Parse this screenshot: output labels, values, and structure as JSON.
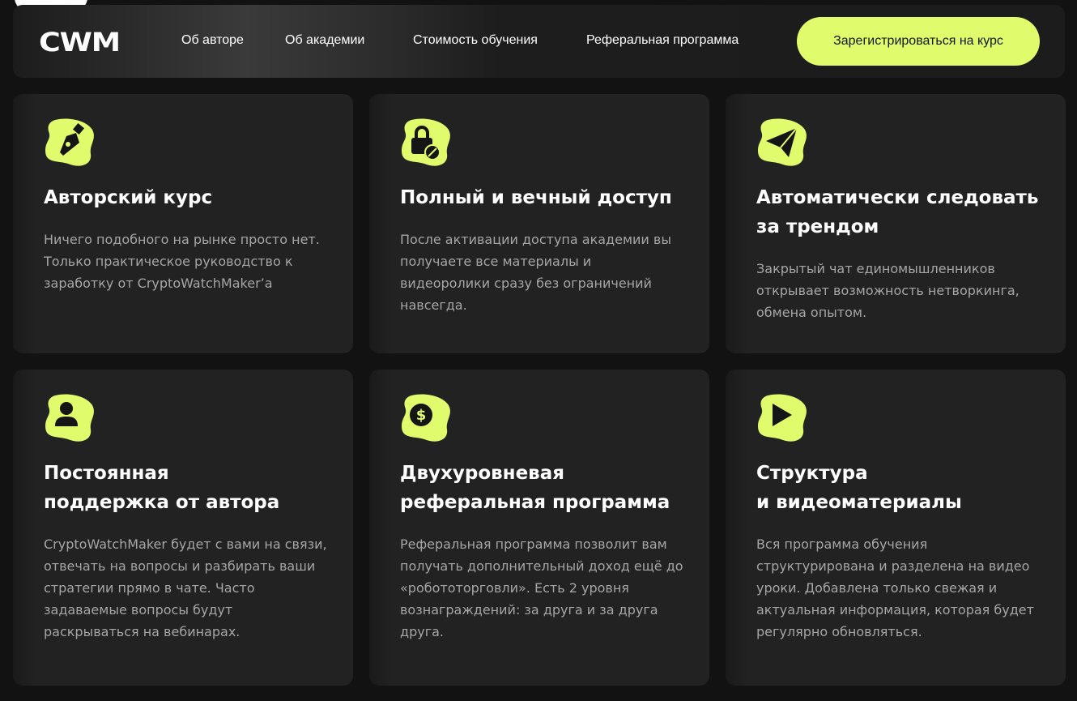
{
  "header": {
    "logo_text": "CWM",
    "nav": [
      {
        "label": "Об авторе"
      },
      {
        "label": "Об академии"
      },
      {
        "label": "Стоимость обучения"
      },
      {
        "label": "Реферальная программа"
      }
    ],
    "cta_label": "Зарегистрироваться на курс"
  },
  "colors": {
    "accent": "#e0fc6c",
    "background": "#121212",
    "card": "#222222",
    "text_muted": "#a6a6a6"
  },
  "features": [
    {
      "icon": "pen-nib-icon",
      "title_lines": [
        "Авторский курс"
      ],
      "description": "Ничего подобного на рынке просто нет. Только практическое руководство к заработку от CryptoWatchMaker’a"
    },
    {
      "icon": "lock-infinity-icon",
      "title_lines": [
        "Полный и вечный доступ"
      ],
      "description": "После активации доступа академии вы получаете все материалы и видеоролики сразу без ограничений навсегда."
    },
    {
      "icon": "paper-plane-icon",
      "title_lines": [
        "Автоматически следовать",
        "за трендом"
      ],
      "description": "Закрытый чат единомышленников открывает возможность нетворкинга, обмена опытом."
    },
    {
      "icon": "user-icon",
      "title_lines": [
        "Постоянная",
        "поддержка от автора"
      ],
      "description": "CryptoWatchMaker будет с вами на связи, отвечать на вопросы и разбирать ваши стратегии прямо в чате. Часто задаваемые вопросы будут раскрываться на вебинарах."
    },
    {
      "icon": "dollar-coin-icon",
      "title_lines": [
        "Двухуровневая",
        "реферальная программа"
      ],
      "description": "Реферальная программа позволит вам получать дополнительный доход ещё до «робототорговли». Есть 2 уровня вознаграждений: за друга и за друга друга."
    },
    {
      "icon": "play-icon",
      "title_lines": [
        "Структура",
        "и видеоматериалы"
      ],
      "description": "Вся программа обучения структурирована и разделена на видео уроки. Добавлена только свежая и актуальная информация, которая будет регулярно обновляться."
    }
  ]
}
